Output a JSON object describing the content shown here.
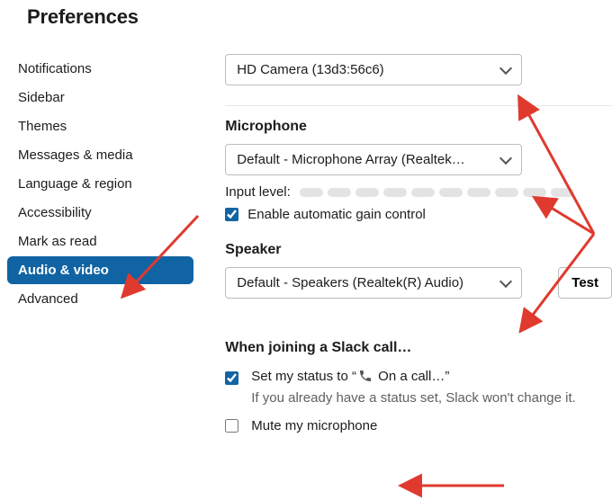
{
  "title": "Preferences",
  "sidebar": {
    "items": [
      {
        "label": "Notifications"
      },
      {
        "label": "Sidebar"
      },
      {
        "label": "Themes"
      },
      {
        "label": "Messages & media"
      },
      {
        "label": "Language & region"
      },
      {
        "label": "Accessibility"
      },
      {
        "label": "Mark as read"
      },
      {
        "label": "Audio & video"
      },
      {
        "label": "Advanced"
      }
    ],
    "active_index": 7
  },
  "camera": {
    "value": "HD Camera (13d3:56c6)"
  },
  "microphone": {
    "heading": "Microphone",
    "value": "Default - Microphone Array (Realtek…",
    "input_level_label": "Input level:",
    "gain_label": "Enable automatic gain control",
    "gain_checked": true
  },
  "speaker": {
    "heading": "Speaker",
    "value": "Default - Speakers (Realtek(R) Audio)",
    "test_label": "Test"
  },
  "joining": {
    "heading": "When joining a Slack call…",
    "status_prefix": "Set my status to “",
    "status_text": " On a call…”",
    "status_checked": true,
    "status_sub": "If you already have a status set, Slack won't change it.",
    "mute_label": "Mute my microphone",
    "mute_checked": false
  }
}
